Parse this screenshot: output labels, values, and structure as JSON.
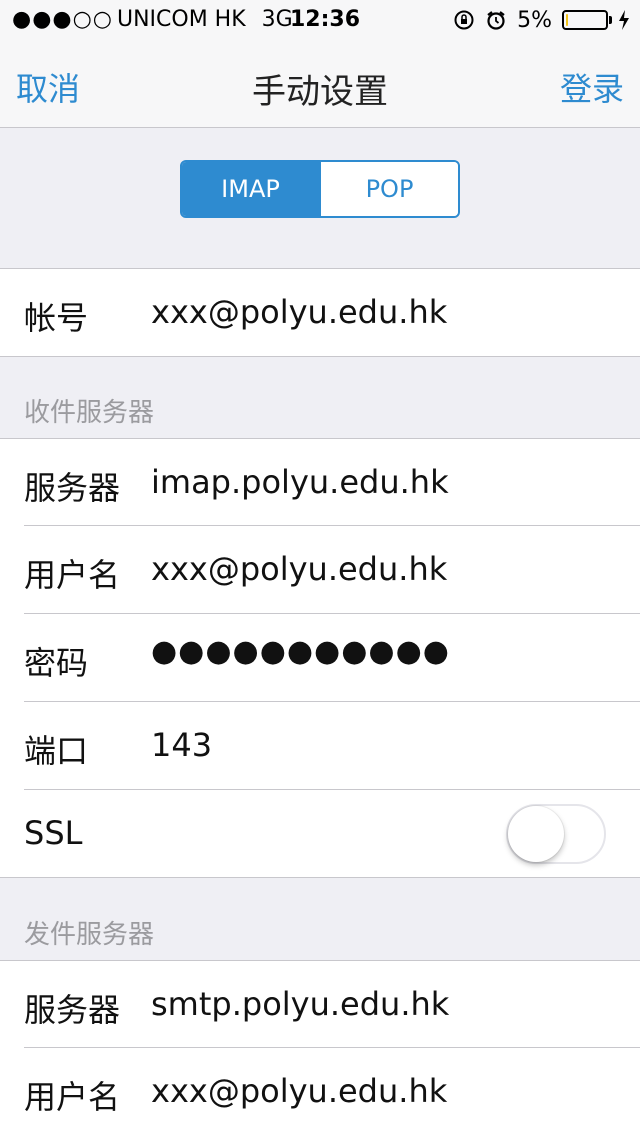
{
  "status_bar": {
    "signal": "●●●○○",
    "carrier": "UNICOM HK",
    "network": "3G",
    "time": "12:36",
    "battery_percent": "5%",
    "battery_level": 0.05,
    "battery_color": "#f3c41a"
  },
  "nav": {
    "cancel": "取消",
    "title": "手动设置",
    "login": "登录"
  },
  "segmented": {
    "options": [
      "IMAP",
      "POP"
    ],
    "selected": "IMAP"
  },
  "account": {
    "label": "帐号",
    "value": "xxx@polyu.edu.hk"
  },
  "incoming": {
    "header": "收件服务器",
    "server_label": "服务器",
    "server_value": "imap.polyu.edu.hk",
    "username_label": "用户名",
    "username_value": "xxx@polyu.edu.hk",
    "password_label": "密码",
    "password_value": "●●●●●●●●●●●",
    "port_label": "端口",
    "port_value": "143",
    "ssl_label": "SSL",
    "ssl_on": false
  },
  "outgoing": {
    "header": "发件服务器",
    "server_label": "服务器",
    "server_value": "smtp.polyu.edu.hk",
    "username_label": "用户名",
    "username_value": "xxx@polyu.edu.hk"
  },
  "colors": {
    "accent": "#2e8bd0",
    "background": "#efeff4"
  }
}
